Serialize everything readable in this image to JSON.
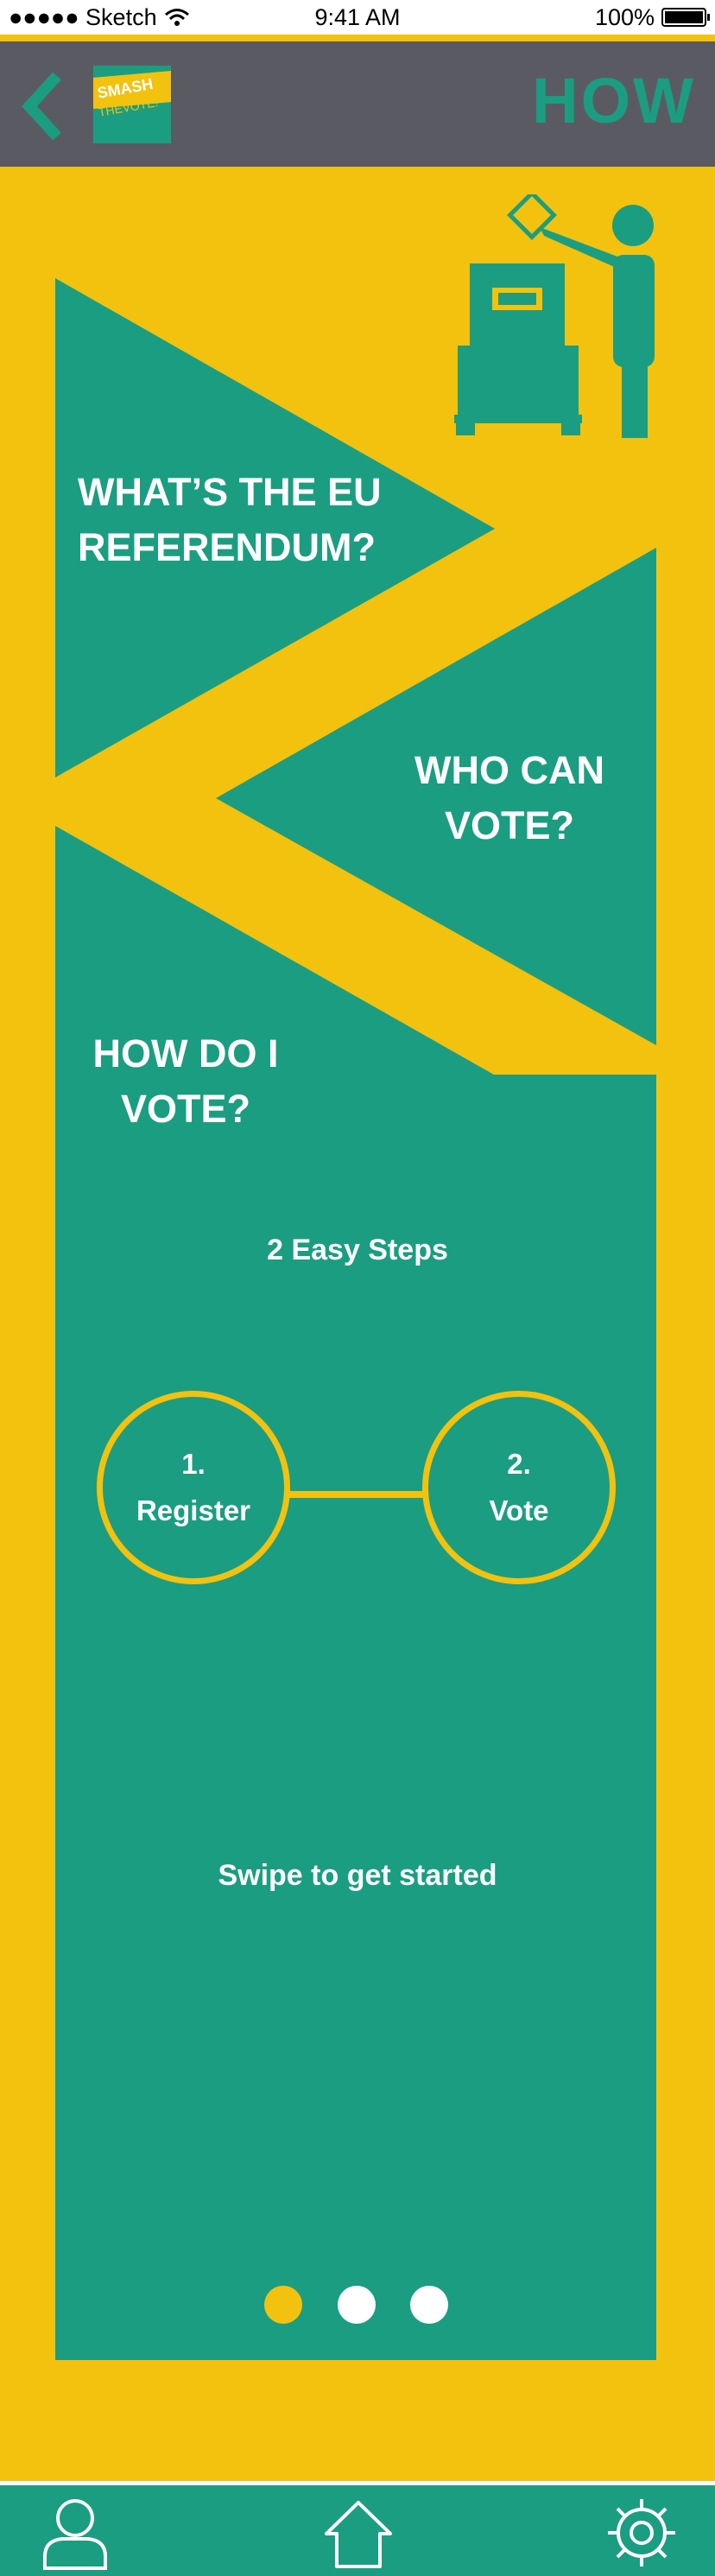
{
  "status_bar": {
    "carrier": "●●●●● Sketch",
    "time": "9:41 AM",
    "battery": "100%"
  },
  "header": {
    "back_icon": "chevron-left-icon",
    "logo_line1": "SMASH",
    "logo_line2": "THEVOTE!",
    "title": "HOW"
  },
  "topics": [
    {
      "line1": "WHAT’S THE EU",
      "line2": "REFERENDUM?"
    },
    {
      "line1": "WHO CAN",
      "line2": "VOTE?"
    },
    {
      "line1": "HOW DO I",
      "line2": "VOTE?"
    }
  ],
  "steps": {
    "title": "2 Easy Steps",
    "items": [
      {
        "number": "1.",
        "label": "Register"
      },
      {
        "number": "2.",
        "label": "Vote"
      }
    ]
  },
  "swipe_text": "Swipe to get started",
  "pagination": {
    "pages": 3,
    "active": 1
  },
  "tab_bar": {
    "items": [
      {
        "icon": "person-icon"
      },
      {
        "icon": "home-icon"
      },
      {
        "icon": "gear-icon"
      }
    ]
  },
  "colors": {
    "yellow": "#f2c20f",
    "teal": "#1b9d81",
    "header_gray": "#5a5b62",
    "white": "#ffffff"
  }
}
